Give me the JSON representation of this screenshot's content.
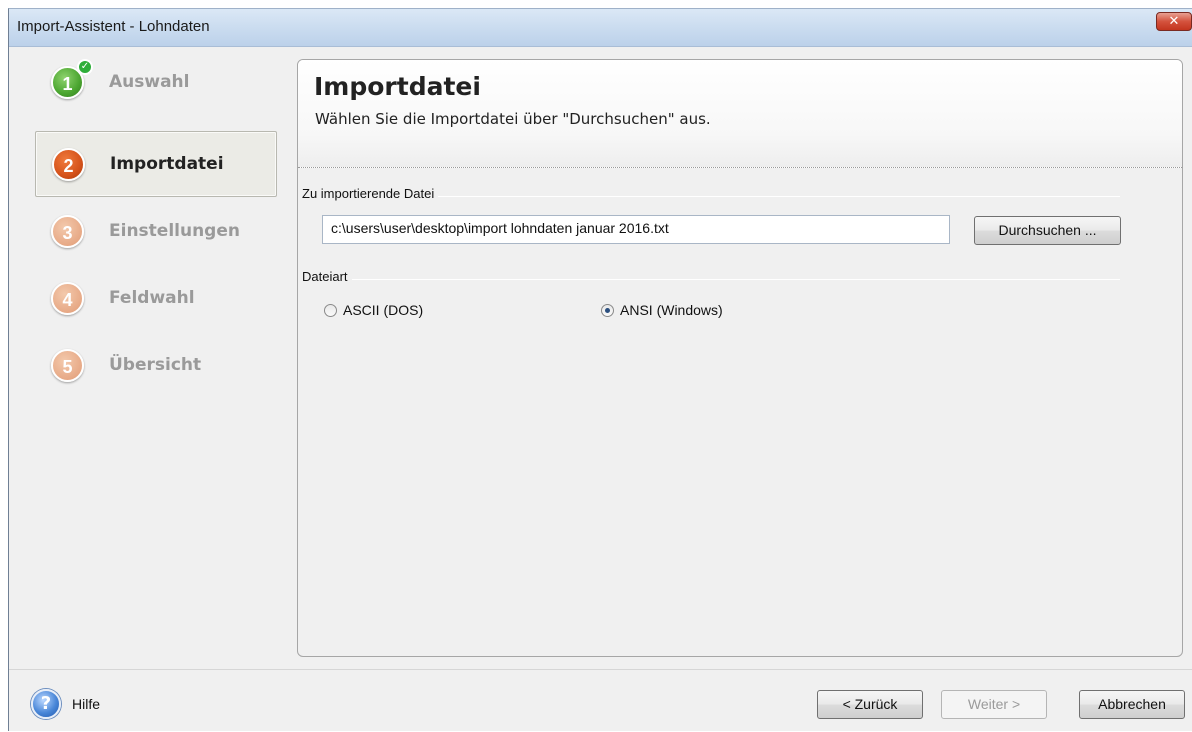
{
  "window": {
    "title": "Import-Assistent - Lohndaten",
    "close_glyph": "✕"
  },
  "steps": [
    {
      "number": "1",
      "label": "Auswahl",
      "state": "done",
      "check": "✓"
    },
    {
      "number": "2",
      "label": "Importdatei",
      "state": "current"
    },
    {
      "number": "3",
      "label": "Einstellungen",
      "state": "pending"
    },
    {
      "number": "4",
      "label": "Feldwahl",
      "state": "pending"
    },
    {
      "number": "5",
      "label": "Übersicht",
      "state": "pending"
    }
  ],
  "panel": {
    "title": "Importdatei",
    "subtitle": "Wählen Sie die Importdatei über \"Durchsuchen\" aus.",
    "file_group_label": "Zu importierende Datei",
    "file_path": "c:\\users\\user\\desktop\\import lohndaten januar 2016.txt",
    "browse_label": "Durchsuchen ...",
    "filetype_group_label": "Dateiart",
    "filetype_options": [
      {
        "label": "ASCII (DOS)",
        "selected": false
      },
      {
        "label": "ANSI (Windows)",
        "selected": true
      }
    ]
  },
  "footer": {
    "help_glyph": "?",
    "help_label": "Hilfe",
    "back_label": "< Zurück",
    "next_label": "Weiter >",
    "next_enabled": false,
    "cancel_label": "Abbrechen"
  },
  "colors": {
    "step_done": "#4aa52f",
    "step_current": "#d5531b",
    "step_pending": "#e7a986",
    "titlebar": "#c9dbef"
  }
}
